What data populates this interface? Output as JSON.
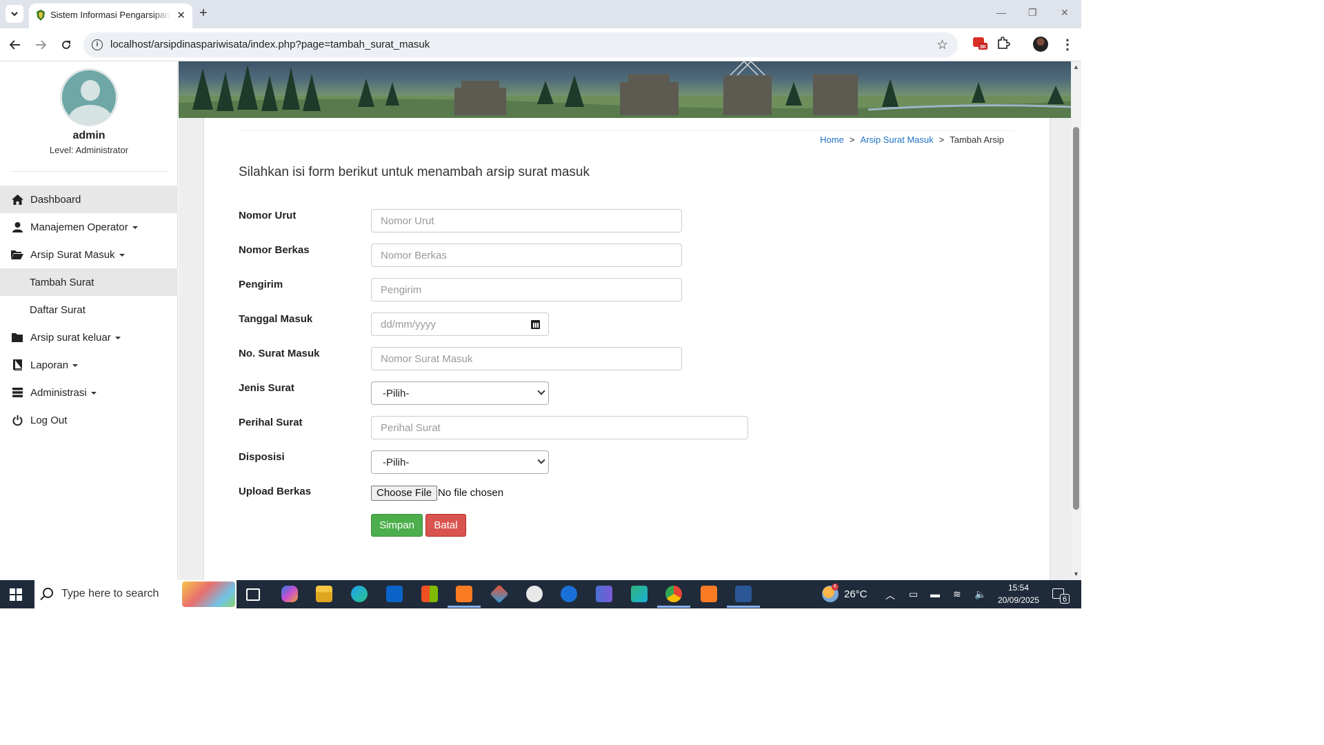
{
  "browser": {
    "tab_title": "Sistem Informasi Pengarsipan D",
    "tab_close": "✕",
    "new_tab": "+",
    "url": "localhost/arsipdinaspariwisata/index.php?page=tambah_surat_masuk",
    "ext_badge": "3K",
    "window_controls": [
      "—",
      "❐",
      "✕"
    ]
  },
  "sidebar": {
    "user_name": "admin",
    "user_level": "Level: Administrator",
    "items": [
      {
        "label": "Dashboard",
        "icon": "home-icon",
        "caret": false
      },
      {
        "label": "Manajemen Operator",
        "icon": "user-icon",
        "caret": true
      },
      {
        "label": "Arsip Surat Masuk",
        "icon": "folder-open-icon",
        "caret": true
      },
      {
        "label": "Tambah Surat",
        "sub": true
      },
      {
        "label": "Daftar Surat",
        "sub": true
      },
      {
        "label": "Arsip surat keluar",
        "icon": "folder-icon",
        "caret": true
      },
      {
        "label": "Laporan",
        "icon": "book-icon",
        "caret": true
      },
      {
        "label": "Administrasi",
        "icon": "tasks-icon",
        "caret": true
      },
      {
        "label": "Log Out",
        "icon": "power-icon",
        "caret": false
      }
    ]
  },
  "breadcrumb": {
    "home": "Home",
    "sep": ">",
    "section": "Arsip Surat Masuk",
    "current": "Tambah Arsip"
  },
  "form": {
    "title": "Silahkan isi form berikut untuk menambah arsip surat masuk",
    "fields": {
      "nomor_urut": {
        "label": "Nomor Urut",
        "placeholder": "Nomor Urut"
      },
      "nomor_berkas": {
        "label": "Nomor Berkas",
        "placeholder": "Nomor Berkas"
      },
      "pengirim": {
        "label": "Pengirim",
        "placeholder": "Pengirim"
      },
      "tanggal_masuk": {
        "label": "Tanggal Masuk",
        "placeholder": "dd/mm/yyyy"
      },
      "no_surat_masuk": {
        "label": "No. Surat Masuk",
        "placeholder": "Nomor Surat Masuk"
      },
      "jenis_surat": {
        "label": "Jenis Surat",
        "value": "-Pilih-"
      },
      "perihal_surat": {
        "label": "Perihal Surat",
        "placeholder": "Perihal Surat"
      },
      "disposisi": {
        "label": "Disposisi",
        "value": "-Pilih-"
      },
      "upload_berkas": {
        "label": "Upload Berkas",
        "button": "Choose File",
        "status": "No file chosen"
      }
    },
    "save_label": "Simpan",
    "cancel_label": "Batal"
  },
  "taskbar": {
    "search_placeholder": "Type here to search",
    "weather_badge": "6",
    "temperature": "26°C",
    "time": "15:54",
    "date": "20/09/2025",
    "notification_count": "6"
  },
  "colors": {
    "link": "#1f73c3",
    "save": "#4cae4c",
    "cancel": "#d9534f",
    "taskbar": "#1f2b3a"
  }
}
